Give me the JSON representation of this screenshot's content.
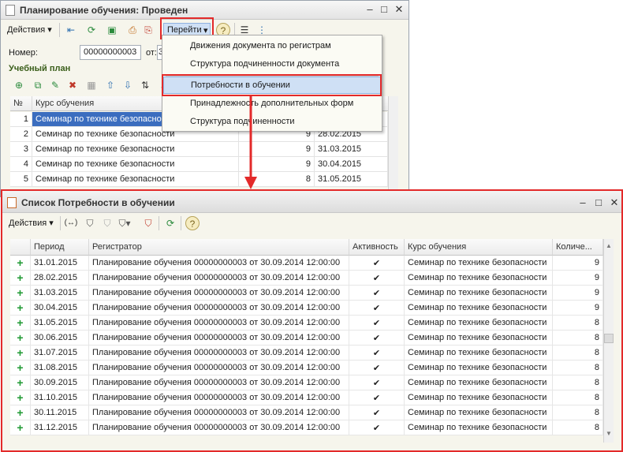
{
  "win1": {
    "title": "Планирование обучения: Проведен",
    "actions_label": "Действия",
    "goto_label": "Перейти",
    "number_label": "Номер:",
    "number_value": "00000000003",
    "from_label": "от:",
    "from_value": "3",
    "section_title": "Учебный план",
    "grid": {
      "headers": [
        "№",
        "Курс обучения"
      ],
      "rows": [
        {
          "n": "1",
          "course": "Семинар по технике безопасно",
          "qty": "",
          "date": ""
        },
        {
          "n": "2",
          "course": "Семинар по технике безопасности",
          "qty": "9",
          "date": "28.02.2015"
        },
        {
          "n": "3",
          "course": "Семинар по технике безопасности",
          "qty": "9",
          "date": "31.03.2015"
        },
        {
          "n": "4",
          "course": "Семинар по технике безопасности",
          "qty": "9",
          "date": "30.04.2015"
        },
        {
          "n": "5",
          "course": "Семинар по технике безопасности",
          "qty": "8",
          "date": "31.05.2015"
        }
      ]
    }
  },
  "menu": {
    "items": [
      "Движения документа по регистрам",
      "Структура подчиненности документа",
      "Потребности в обучении",
      "Принадлежность дополнительных форм",
      "Структура подчиненности"
    ]
  },
  "win2": {
    "title": "Список Потребности в обучении",
    "actions_label": "Действия",
    "headers": [
      "Период",
      "Регистратор",
      "Активность",
      "Курс обучения",
      "Количе..."
    ],
    "check_mark": "✔",
    "plus_mark": "+",
    "rows": [
      {
        "period": "31.01.2015",
        "registrar": "Планирование обучения 00000000003 от 30.09.2014 12:00:00",
        "course": "Семинар по технике безопасности",
        "qty": "9"
      },
      {
        "period": "28.02.2015",
        "registrar": "Планирование обучения 00000000003 от 30.09.2014 12:00:00",
        "course": "Семинар по технике безопасности",
        "qty": "9"
      },
      {
        "period": "31.03.2015",
        "registrar": "Планирование обучения 00000000003 от 30.09.2014 12:00:00",
        "course": "Семинар по технике безопасности",
        "qty": "9"
      },
      {
        "period": "30.04.2015",
        "registrar": "Планирование обучения 00000000003 от 30.09.2014 12:00:00",
        "course": "Семинар по технике безопасности",
        "qty": "9"
      },
      {
        "period": "31.05.2015",
        "registrar": "Планирование обучения 00000000003 от 30.09.2014 12:00:00",
        "course": "Семинар по технике безопасности",
        "qty": "8"
      },
      {
        "period": "30.06.2015",
        "registrar": "Планирование обучения 00000000003 от 30.09.2014 12:00:00",
        "course": "Семинар по технике безопасности",
        "qty": "8"
      },
      {
        "period": "31.07.2015",
        "registrar": "Планирование обучения 00000000003 от 30.09.2014 12:00:00",
        "course": "Семинар по технике безопасности",
        "qty": "8"
      },
      {
        "period": "31.08.2015",
        "registrar": "Планирование обучения 00000000003 от 30.09.2014 12:00:00",
        "course": "Семинар по технике безопасности",
        "qty": "8"
      },
      {
        "period": "30.09.2015",
        "registrar": "Планирование обучения 00000000003 от 30.09.2014 12:00:00",
        "course": "Семинар по технике безопасности",
        "qty": "8"
      },
      {
        "period": "31.10.2015",
        "registrar": "Планирование обучения 00000000003 от 30.09.2014 12:00:00",
        "course": "Семинар по технике безопасности",
        "qty": "8"
      },
      {
        "period": "30.11.2015",
        "registrar": "Планирование обучения 00000000003 от 30.09.2014 12:00:00",
        "course": "Семинар по технике безопасности",
        "qty": "8"
      },
      {
        "period": "31.12.2015",
        "registrar": "Планирование обучения 00000000003 от 30.09.2014 12:00:00",
        "course": "Семинар по технике безопасности",
        "qty": "8"
      }
    ]
  },
  "colors": {
    "highlight_red": "#e32a2a",
    "selection_blue": "#3b6dbf",
    "menu_highlight": "#cfe0f5",
    "plus_green": "#1f9a33"
  }
}
